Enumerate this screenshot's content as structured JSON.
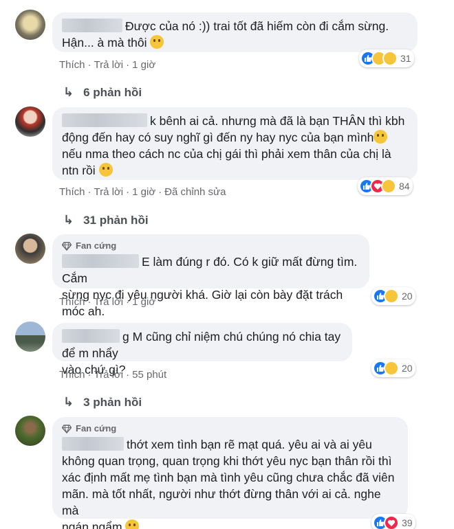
{
  "comments": [
    {
      "fan_badge": "",
      "text1": "Được của nó :)) trai tốt đã hiếm còn đi cắm sừng.",
      "text2": "Hận... à mà thôi",
      "like_label": "Thích",
      "reply_label": "Trả lời",
      "time": "1 giờ",
      "edited": "",
      "reaction_count": "31",
      "replies": "6 phản hồi"
    },
    {
      "fan_badge": "",
      "text1": "k bênh ai cả. nhưng mà đã là bạn THÂN thì kbh",
      "text2": "động đến hay có suy nghĩ gì đến ny hay nyc của bạn mình",
      "text3": "nếu nma theo cách nc của chị gái thì phải xem thân của chị là",
      "text4": "ntn rồi",
      "like_label": "Thích",
      "reply_label": "Trả lời",
      "time": "1 giờ",
      "edited": "Đã chỉnh sửa",
      "reaction_count": "84",
      "replies": "31 phản hồi"
    },
    {
      "fan_badge": "Fan cứng",
      "text1": "E làm đúng r đó. Có k giữ mất đừng tìm. Cắm",
      "text2": "sừng nyc đi yêu người khá. Giờ lại còn bày đặt trách móc ah.",
      "like_label": "Thích",
      "reply_label": "Trả lời",
      "time": "1 giờ",
      "edited": "",
      "reaction_count": "20",
      "replies": ""
    },
    {
      "fan_badge": "",
      "text1": "g M cũng chỉ niệm chú chúng nó chia tay để m nhẩy",
      "text2": "vào chứ gì?",
      "like_label": "Thích",
      "reply_label": "Trả lời",
      "time": "55 phút",
      "edited": "",
      "reaction_count": "20",
      "replies": "3 phản hồi"
    },
    {
      "fan_badge": "Fan cứng",
      "text1": "thớt xem tình bạn rẽ mạt quá. yêu ai và ai yêu",
      "text2": "không quan trọng, quan trọng khi thớt yêu nyc bạn thân rồi thì",
      "text3": "xác định mất mẹ tình bạn mà tình yêu cũng chưa chắc đã viên",
      "text4": "mãn. mà tốt nhất, người như thớt đừng thân với ai cả. nghe mà",
      "text5": "ngán ngẩm",
      "reaction_count": "39"
    }
  ],
  "colors": {
    "bubble": "#f0f2f5",
    "like_blue": "#1877f2",
    "love_red": "#f0284a",
    "emoji_yellow": "#f7c53a"
  }
}
